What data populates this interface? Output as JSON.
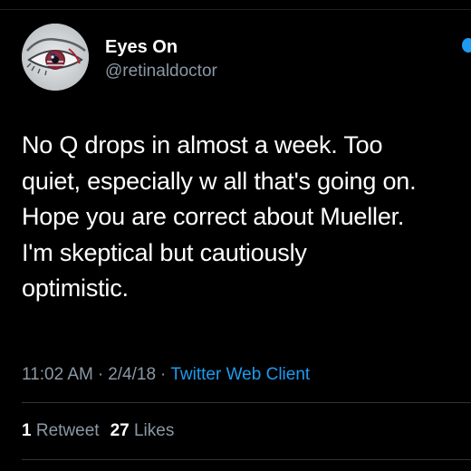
{
  "author": {
    "display_name": "Eyes On",
    "handle": "@retinaldoctor",
    "avatar_icon": "eye-icon"
  },
  "tweet": {
    "text": "No Q drops in almost a week. Too\nquiet, especially w all that's going on.\nHope you are correct about Mueller.\nI'm skeptical but cautiously\noptimistic."
  },
  "meta": {
    "time": "11:02 AM",
    "separator": "·",
    "date": "2/4/18",
    "client": "Twitter Web Client"
  },
  "stats": {
    "retweets_count": "1",
    "retweets_label": "Retweet",
    "likes_count": "27",
    "likes_label": "Likes"
  },
  "colors": {
    "background": "#000000",
    "text": "#ffffff",
    "secondary": "#8b98a5",
    "accent": "#1d9bf0"
  }
}
